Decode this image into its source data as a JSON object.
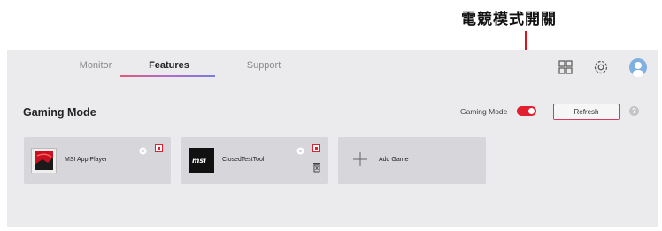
{
  "annotation": {
    "label": "電競模式開關"
  },
  "tabs": [
    {
      "label": "Monitor"
    },
    {
      "label": "Features"
    },
    {
      "label": "Support"
    }
  ],
  "header_icons": [
    "grid-icon",
    "gear-icon",
    "avatar"
  ],
  "section": {
    "title": "Gaming Mode"
  },
  "gaming_mode": {
    "label": "Gaming Mode",
    "enabled": true
  },
  "refresh": {
    "label": "Refresh"
  },
  "help": {
    "glyph": "?"
  },
  "games": [
    {
      "name": "MSI App Player"
    },
    {
      "name": "ClosedTestTool"
    }
  ],
  "add_game": {
    "label": "Add Game"
  },
  "colors": {
    "accent_red": "#e0202e",
    "background": "#ebebed",
    "card": "#d6d6db"
  }
}
